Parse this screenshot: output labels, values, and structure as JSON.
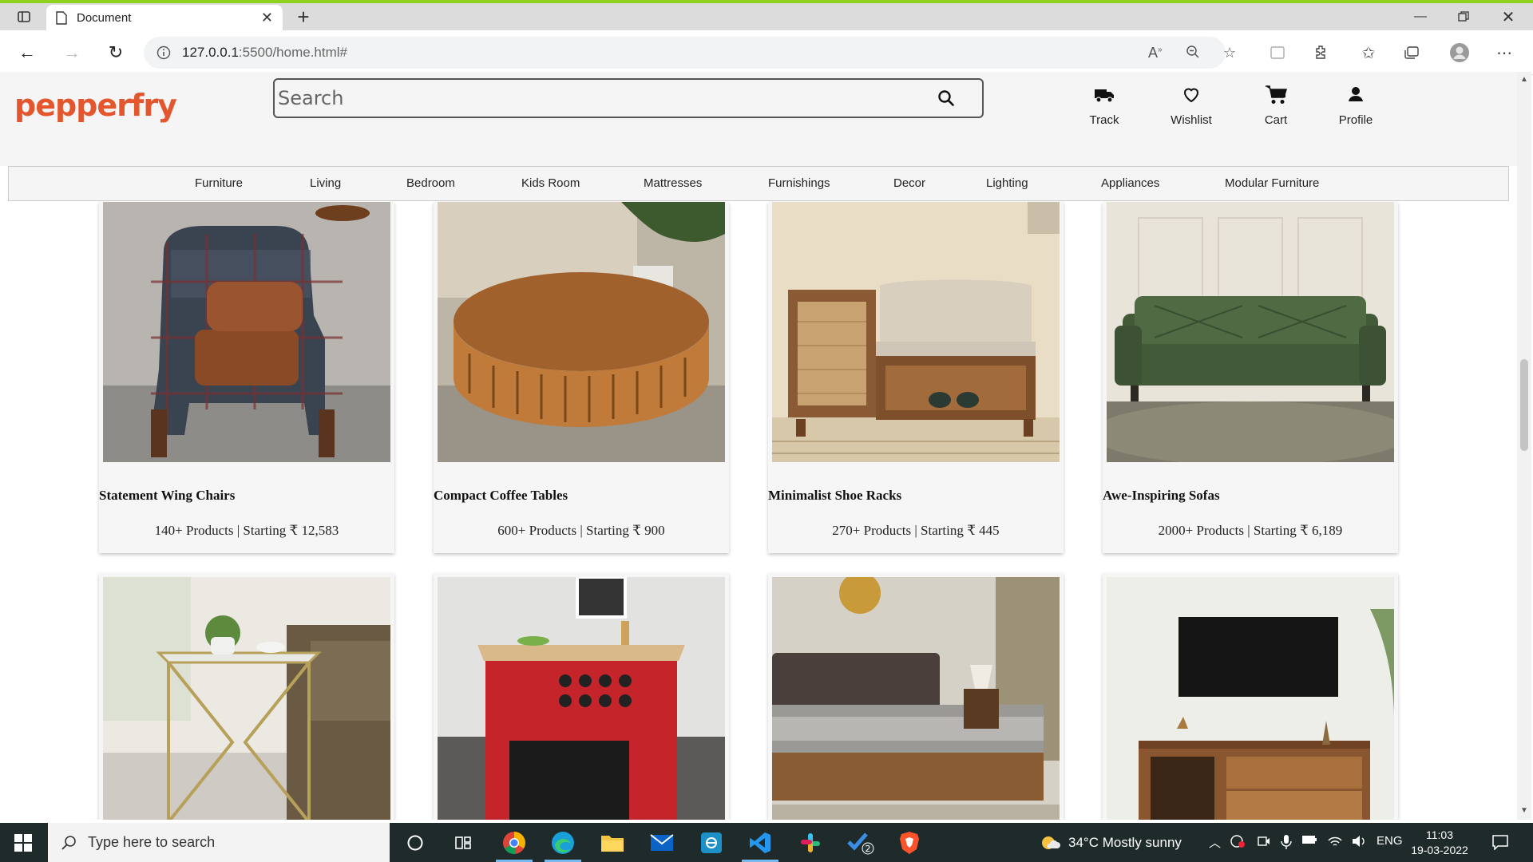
{
  "browser": {
    "tab_title": "Document",
    "url": "127.0.0.1:5500/home.html#",
    "url_host": "127.0.0.1",
    "url_rest": ":5500/home.html#"
  },
  "site": {
    "logo": "pepperfry",
    "search_placeholder": "Search",
    "actions": [
      {
        "label": "Track",
        "icon": "truck-icon"
      },
      {
        "label": "Wishlist",
        "icon": "heart-icon"
      },
      {
        "label": "Cart",
        "icon": "cart-icon"
      },
      {
        "label": "Profile",
        "icon": "user-icon"
      }
    ],
    "categories": [
      "Furniture",
      "Living",
      "Bedroom",
      "Kids Room",
      "Mattresses",
      "Furnishings",
      "Decor",
      "Lighting",
      "Appliances",
      "Modular Furniture"
    ]
  },
  "products": [
    {
      "title": "Statement Wing Chairs",
      "meta": "140+ Products | Starting ₹ 12,583"
    },
    {
      "title": "Compact Coffee Tables",
      "meta": "600+ Products | Starting ₹ 900"
    },
    {
      "title": "Minimalist Shoe Racks",
      "meta": "270+ Products | Starting ₹ 445"
    },
    {
      "title": "Awe-Inspiring Sofas",
      "meta": "2000+ Products | Starting ₹ 6,189"
    }
  ],
  "taskbar": {
    "search_placeholder": "Type here to search",
    "weather": "34°C  Mostly sunny",
    "language": "ENG",
    "time": "11:03",
    "date": "19-03-2022",
    "badge": "2"
  },
  "colors": {
    "brand": "#e4572e",
    "accent_border": "#8fd11f",
    "taskbar": "#1f2a2a"
  }
}
